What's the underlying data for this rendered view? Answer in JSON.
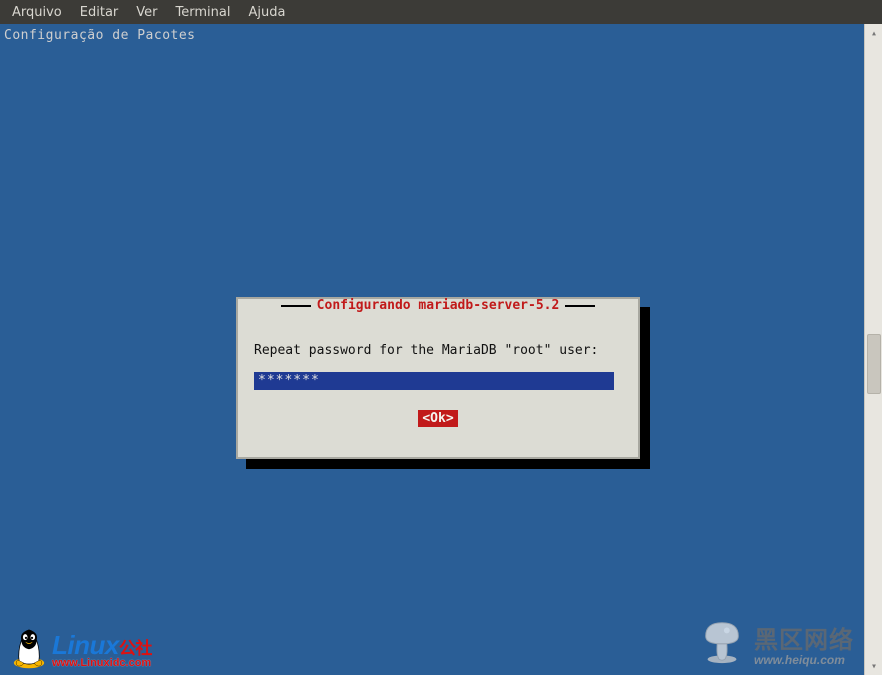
{
  "menubar": {
    "items": [
      {
        "label": "Arquivo"
      },
      {
        "label": "Editar"
      },
      {
        "label": "Ver"
      },
      {
        "label": "Terminal"
      },
      {
        "label": "Ajuda"
      }
    ]
  },
  "terminal": {
    "title": "Configuração de Pacotes"
  },
  "dialog": {
    "title": "Configurando mariadb-server-5.2",
    "prompt": "Repeat password for the MariaDB \"root\" user:",
    "password_mask": "*******",
    "ok_label": "<Ok>"
  },
  "watermark_left": {
    "brand": "Linux",
    "brand_suffix": "公社",
    "url": "www.Linuxidc.com"
  },
  "watermark_right": {
    "brand": "黑区网络",
    "url": "www.heiqu.com"
  }
}
